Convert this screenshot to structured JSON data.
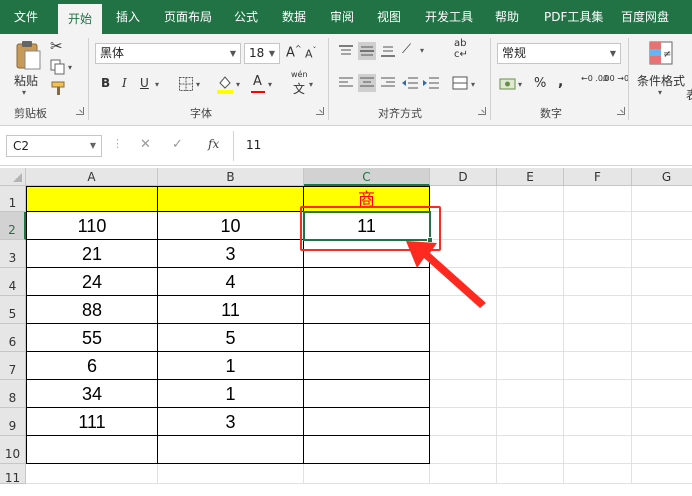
{
  "menu": {
    "items": [
      "文件",
      "开始",
      "插入",
      "页面布局",
      "公式",
      "数据",
      "审阅",
      "视图",
      "开发工具",
      "帮助",
      "PDF工具集",
      "百度网盘"
    ],
    "active_index": 1
  },
  "ribbon": {
    "clipboard": {
      "paste_label": "粘贴",
      "group_label": "剪贴板"
    },
    "font": {
      "font_name": "黑体",
      "font_size": "18",
      "bold": "B",
      "italic": "I",
      "underline": "U",
      "grow": "A",
      "shrink": "A",
      "phonetic_top": "wén",
      "phonetic_bottom": "文",
      "group_label": "字体"
    },
    "alignment": {
      "group_label": "对齐方式",
      "wrap_glyph": "ab",
      "wrap_sub": "c"
    },
    "number": {
      "format": "常规",
      "percent": "%",
      "comma": ",",
      "inc_decimal": "←0 .00",
      "dec_decimal": ".00 →0",
      "group_label": "数字"
    },
    "styles": {
      "conditional_format_label": "条件格式",
      "truncated_label": "表"
    }
  },
  "formula_bar": {
    "name_box": "C2",
    "formula": "11",
    "fx": "fx"
  },
  "sheet": {
    "columns": [
      "A",
      "B",
      "C",
      "D",
      "E",
      "F",
      "G"
    ],
    "rows": [
      "1",
      "2",
      "3",
      "4",
      "5",
      "6",
      "7",
      "8",
      "9",
      "10",
      "11"
    ],
    "selected_cell": "C2",
    "cells": [
      [
        "",
        "",
        "商"
      ],
      [
        "110",
        "10",
        "11"
      ],
      [
        "21",
        "3",
        ""
      ],
      [
        "24",
        "4",
        ""
      ],
      [
        "88",
        "11",
        ""
      ],
      [
        "55",
        "5",
        ""
      ],
      [
        "6",
        "1",
        ""
      ],
      [
        "34",
        "1",
        ""
      ],
      [
        "111",
        "3",
        ""
      ],
      [
        "",
        "",
        ""
      ]
    ]
  },
  "colors": {
    "brand": "#217346",
    "header_fill": "#ffff00",
    "annotation": "#ff2a1f"
  }
}
